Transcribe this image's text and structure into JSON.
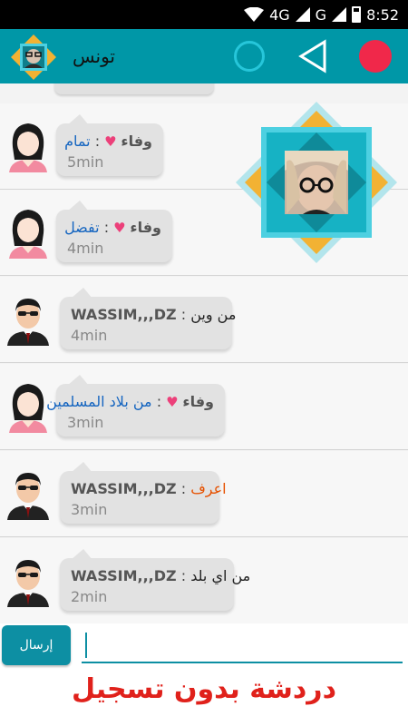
{
  "status_bar": {
    "network": "4G",
    "network2": "G",
    "time": "8:52"
  },
  "header": {
    "title": "تونس"
  },
  "messages": [
    {
      "sender": "وفاء",
      "text": "تمام",
      "time": "5min",
      "avatar": "female-avatar",
      "style": "blue"
    },
    {
      "sender": "وفاء",
      "text": "تفضل",
      "time": "4min",
      "avatar": "female-avatar",
      "style": "blue"
    },
    {
      "sender": "WASSIM,,,DZ",
      "text": "من وين",
      "time": "4min",
      "avatar": "male-avatar",
      "style": "dark"
    },
    {
      "sender": "وفاء",
      "text": "من بلاد المسلمين",
      "time": "3min",
      "avatar": "female-avatar",
      "style": "blue"
    },
    {
      "sender": "WASSIM,,,DZ",
      "text": "اعرف",
      "time": "3min",
      "avatar": "male-avatar",
      "style": "orange"
    },
    {
      "sender": "WASSIM,,,DZ",
      "text": "من اي بلد",
      "time": "2min",
      "avatar": "male-avatar",
      "style": "dark"
    }
  ],
  "composer": {
    "send_label": "إرسال",
    "input_value": "",
    "input_placeholder": ""
  },
  "footer": {
    "banner": "دردشة بدون تسجيل"
  },
  "colors": {
    "accent": "#0097a7",
    "record": "#f0284a",
    "banner": "#e0211b"
  }
}
